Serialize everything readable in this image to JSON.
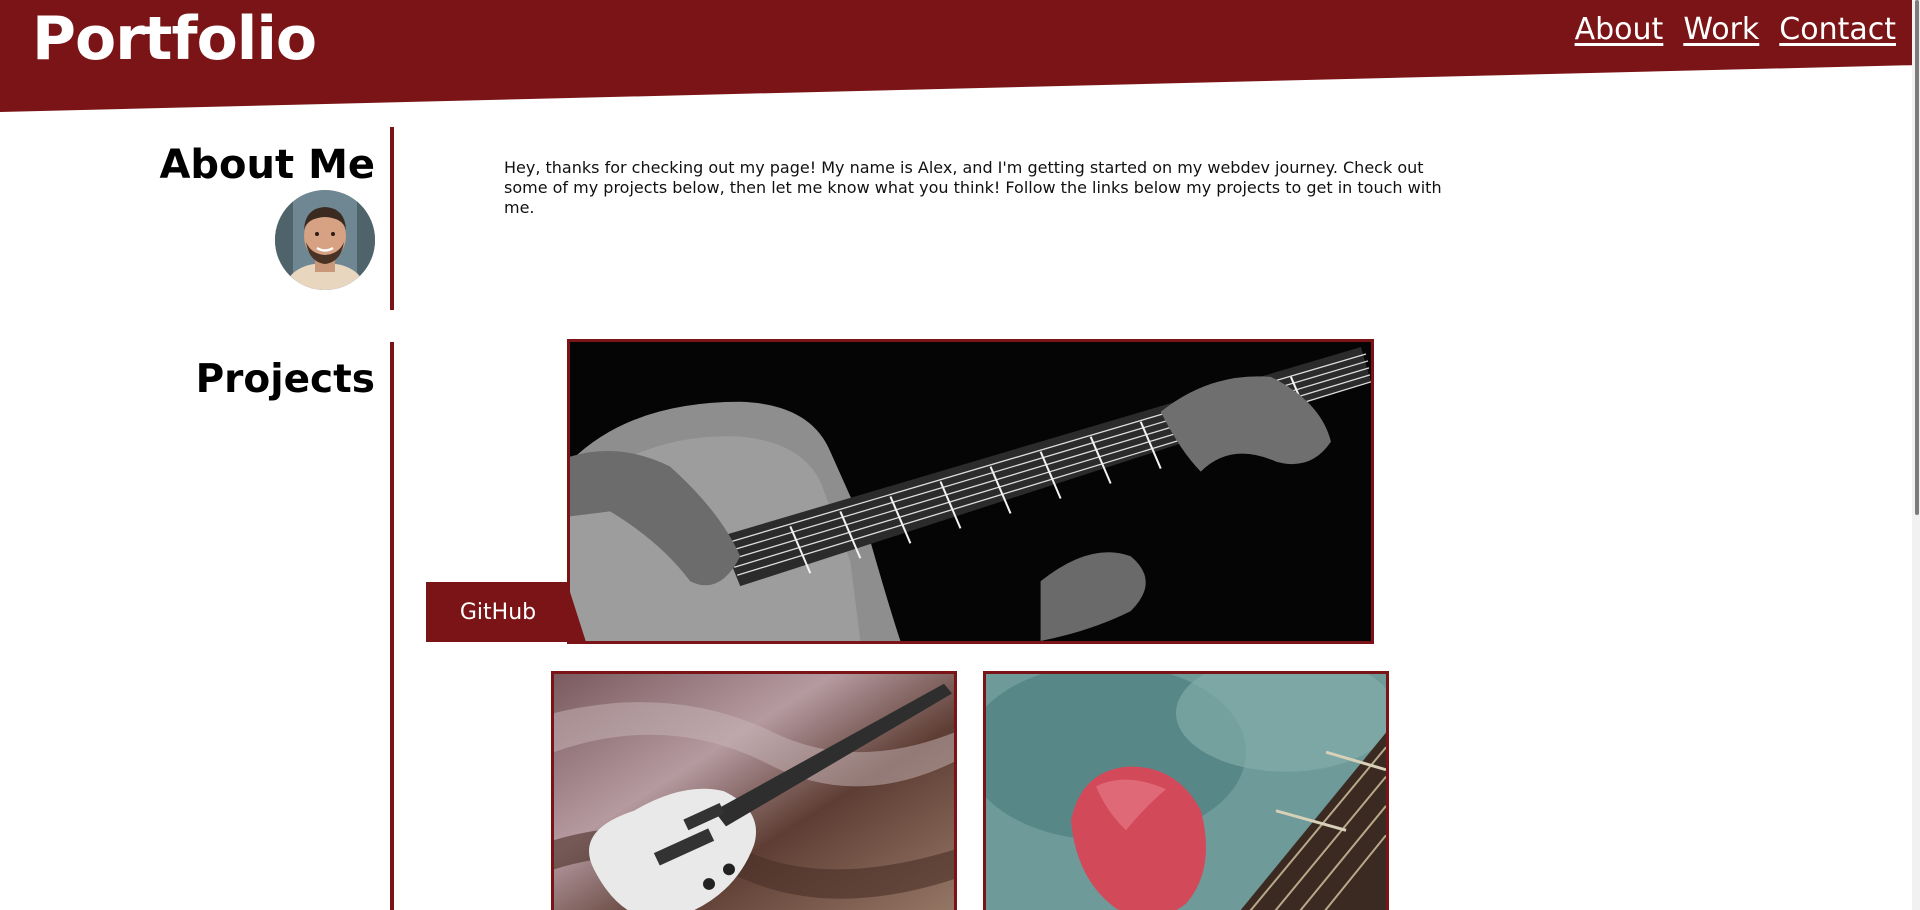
{
  "header": {
    "brand": "Portfolio",
    "nav": [
      {
        "label": "About"
      },
      {
        "label": "Work"
      },
      {
        "label": "Contact"
      }
    ]
  },
  "about": {
    "title": "About Me",
    "text": "Hey, thanks for checking out my page! My name is Alex, and I'm getting started on my webdev journey. Check out some of my projects below, then let me know what you think! Follow the links below my projects to get in touch with me."
  },
  "projects": {
    "title": "Projects",
    "github_label": "GitHub",
    "items": [
      {
        "image": "acoustic-guitar-photo"
      },
      {
        "image": "electric-guitar-photo"
      },
      {
        "image": "guitar-pick-photo"
      }
    ]
  },
  "colors": {
    "accent": "#7b1416",
    "background": "#ffffff",
    "text": "#111111"
  }
}
